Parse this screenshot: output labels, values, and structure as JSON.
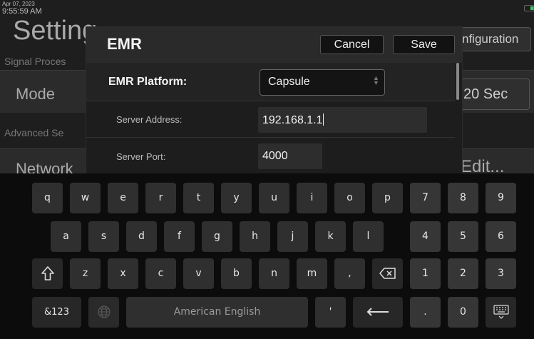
{
  "status": {
    "date": "Apr 07, 2023",
    "time": "9:55:59 AM"
  },
  "background": {
    "title": "Setting",
    "section_signal": "Signal Proces",
    "configuration_button": "nfiguration",
    "row_mode": "Mode",
    "mode_value": "20 Sec",
    "section_advanced": "Advanced Se",
    "row_network": "Network",
    "network_value": "Edit..."
  },
  "modal": {
    "title": "EMR",
    "cancel_label": "Cancel",
    "save_label": "Save",
    "platform_label": "EMR Platform:",
    "platform_value": "Capsule",
    "address_label": "Server Address:",
    "address_value": "192.168.1.1",
    "port_label": "Server Port:",
    "port_value": "4000"
  },
  "keyboard": {
    "row1": [
      "q",
      "w",
      "e",
      "r",
      "t",
      "y",
      "u",
      "i",
      "o",
      "p"
    ],
    "row2": [
      "a",
      "s",
      "d",
      "f",
      "g",
      "h",
      "j",
      "k",
      "l"
    ],
    "row3": [
      "z",
      "x",
      "c",
      "v",
      "b",
      "n",
      "m",
      ","
    ],
    "numpad_row1": [
      "7",
      "8",
      "9"
    ],
    "numpad_row2": [
      "4",
      "5",
      "6"
    ],
    "numpad_row3": [
      "1",
      "2",
      "3"
    ],
    "mode_key": "&123",
    "space_label": "American English",
    "apostrophe": "'",
    "dot": ".",
    "zero": "0",
    "icons": [
      "shift-icon",
      "backspace-icon",
      "globe-icon",
      "enter-icon",
      "hide-keyboard-icon"
    ]
  }
}
